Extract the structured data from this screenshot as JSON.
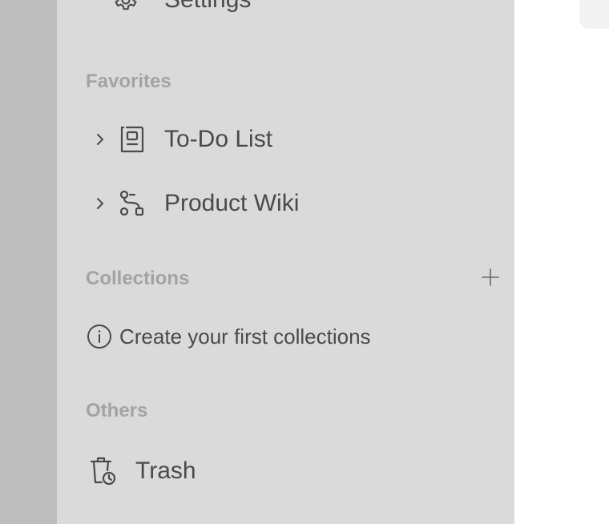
{
  "sidebar": {
    "settings": {
      "label": "Settings",
      "icon": "gear-icon"
    },
    "favorites": {
      "title": "Favorites",
      "items": [
        {
          "label": "To-Do List",
          "icon": "page-icon"
        },
        {
          "label": "Product Wiki",
          "icon": "edgeless-icon"
        }
      ]
    },
    "collections": {
      "title": "Collections",
      "add_icon": "plus-icon",
      "empty_hint": "Create your first collections",
      "hint_icon": "info-icon"
    },
    "others": {
      "title": "Others",
      "trash_label": "Trash",
      "trash_icon": "trash-icon"
    }
  },
  "colors": {
    "sidebar_bg": "#dadada",
    "left_strip_bg": "#bdbdbd",
    "text": "#4a4a4a",
    "section_title": "#a3a3a3"
  }
}
